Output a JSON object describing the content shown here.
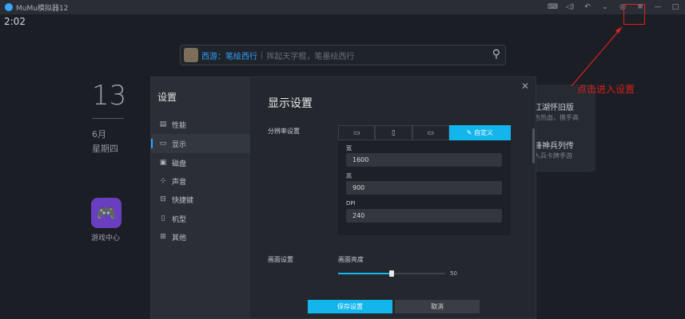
{
  "titlebar": {
    "app_title": "MuMu模拟器12",
    "icons": [
      "keyboard-icon",
      "volume-icon",
      "back-icon",
      "chevron-icon",
      "record-icon",
      "menu-icon",
      "minimize-icon",
      "maximize-icon"
    ]
  },
  "status": {
    "time": "2:02"
  },
  "search": {
    "highlight": "西游：笔绘西行",
    "placeholder": "挥起天字棍，笔墨绘西行"
  },
  "desktop": {
    "date_day": "13",
    "date_month": "6月",
    "date_weekday": "星期四",
    "game_center_label": "游戏中心",
    "card_line1": "江湖怀旧版",
    "card_line2": "色热血，携手高",
    "card_line3": "锋神兵列传",
    "card_line4": "入兵卡牌手游"
  },
  "annotation": {
    "text": "点击进入设置",
    "color": "#d81e1e"
  },
  "dialog": {
    "sidebar_title": "设置",
    "nav": [
      {
        "label": "性能",
        "icon": "performance-icon"
      },
      {
        "label": "显示",
        "icon": "display-icon"
      },
      {
        "label": "磁盘",
        "icon": "disk-icon"
      },
      {
        "label": "声音",
        "icon": "sound-icon"
      },
      {
        "label": "快捷键",
        "icon": "keyboard-icon"
      },
      {
        "label": "机型",
        "icon": "phone-icon"
      },
      {
        "label": "其他",
        "icon": "grid-icon"
      }
    ],
    "main_title": "显示设置",
    "resolution_label": "分辨率设置",
    "tabs": {
      "custom": "自定义"
    },
    "width_label": "宽",
    "width_value": "1600",
    "height_label": "高",
    "height_value": "900",
    "dpi_label": "DPI",
    "dpi_value": "240",
    "picture_label": "画面设置",
    "brightness_label": "画面亮度",
    "brightness_value": "50",
    "brightness_fraction": 0.5,
    "save_label": "保存设置",
    "cancel_label": "取消",
    "accent_color": "#12b5ec"
  }
}
